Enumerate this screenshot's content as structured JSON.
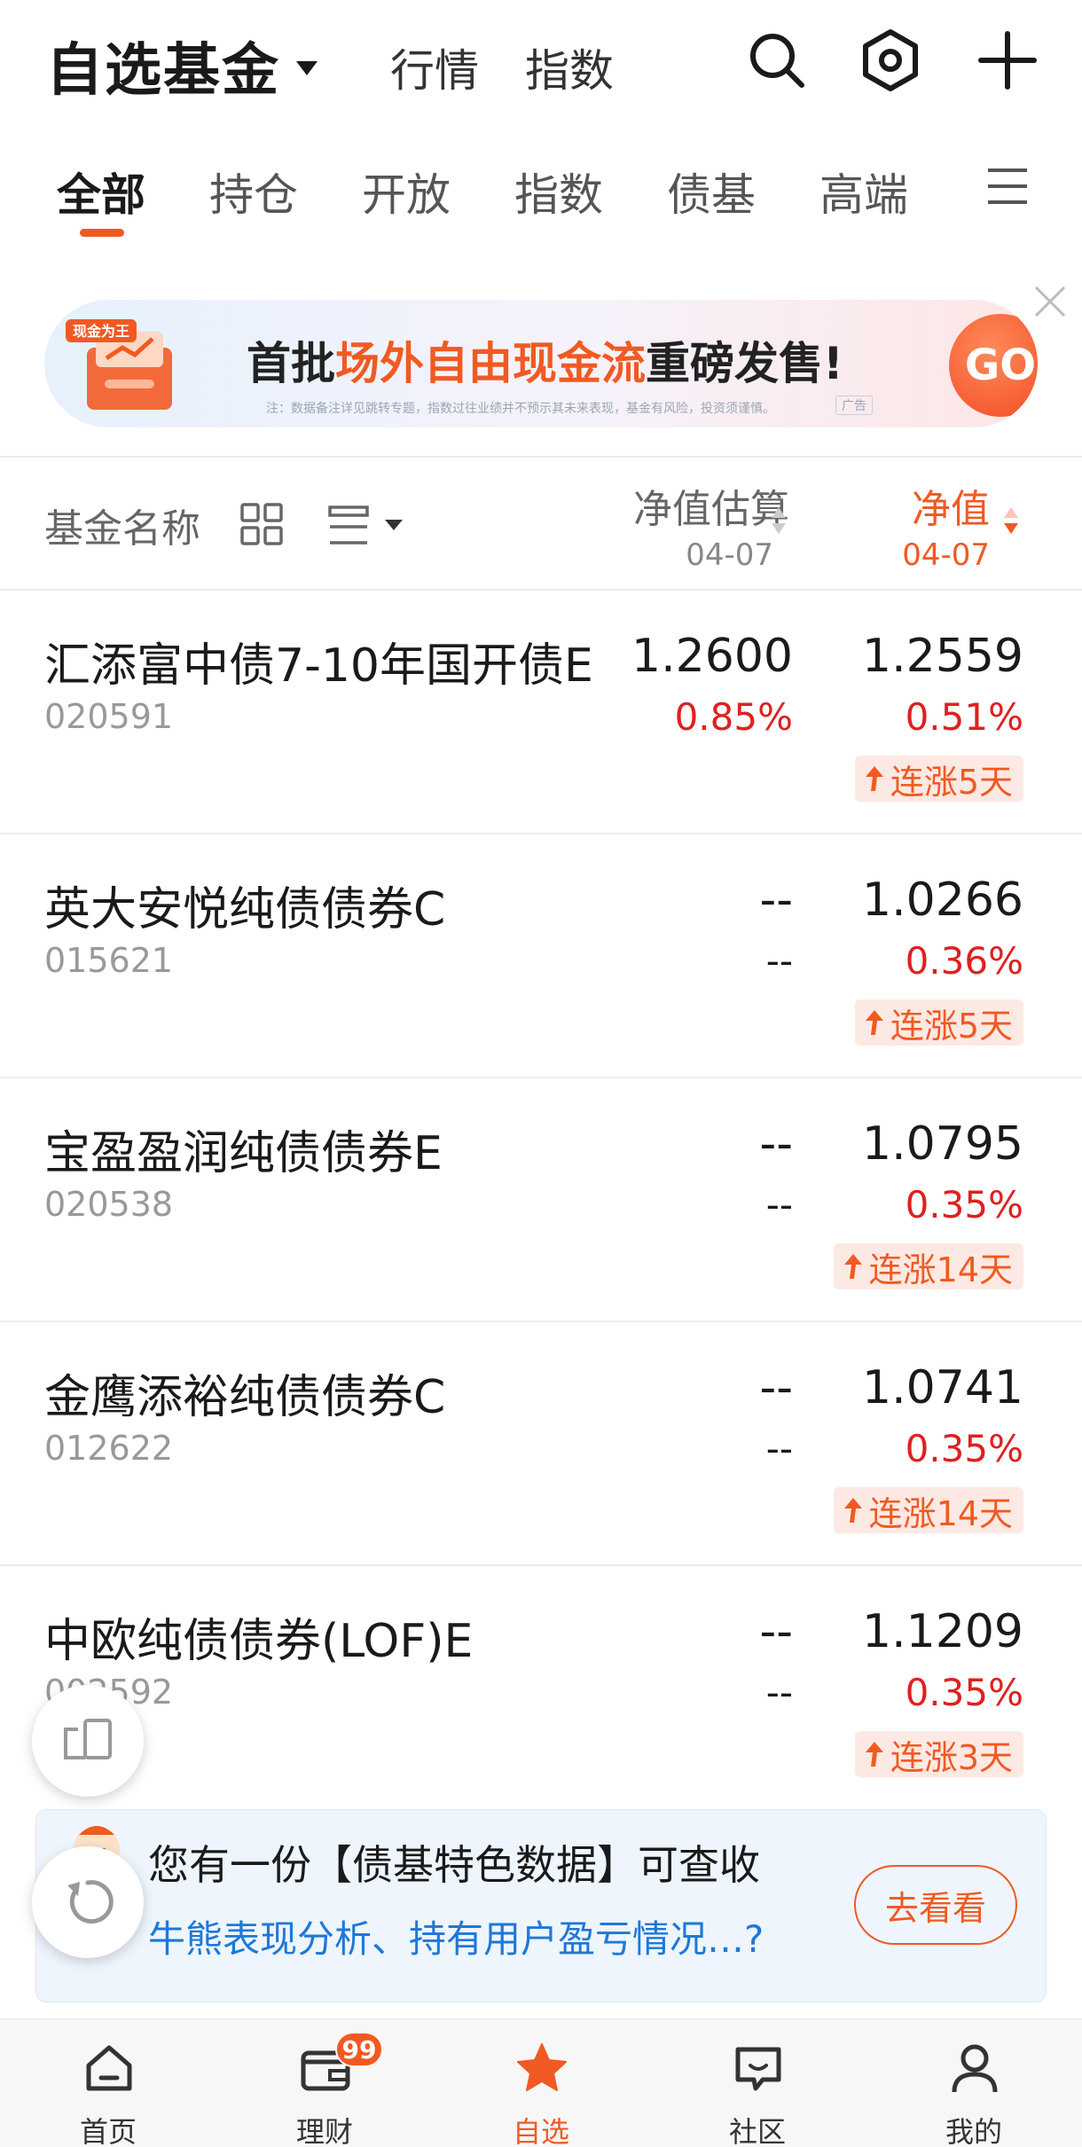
{
  "header": {
    "title": "自选基金",
    "links": [
      "行情",
      "指数"
    ]
  },
  "tabs": [
    "全部",
    "持仓",
    "开放",
    "指数",
    "债基",
    "高端"
  ],
  "banner": {
    "badge_text": "现金为王",
    "text_pre": "首批",
    "text_highlight": "场外自由现金流",
    "text_post": "重磅发售!",
    "note": "注：数据备注详见跳转专题，指数过往业绩并不预示其未来表现，基金有风险，投资须谨慎。",
    "ad_label": "广告",
    "go_label": "GO"
  },
  "columns": {
    "name": "基金名称",
    "estimate_label": "净值估算",
    "estimate_date": "04-07",
    "nav_label": "净值",
    "nav_date": "04-07"
  },
  "funds": [
    {
      "name": "汇添富中债7-10年国开债E",
      "code": "020591",
      "est": "1.2600",
      "est_pct": "0.85%",
      "nav": "1.2559",
      "nav_pct": "0.51%",
      "streak": "连涨5天"
    },
    {
      "name": "英大安悦纯债债券C",
      "code": "015621",
      "est": "--",
      "est_pct": "--",
      "nav": "1.0266",
      "nav_pct": "0.36%",
      "streak": "连涨5天"
    },
    {
      "name": "宝盈盈润纯债债券E",
      "code": "020538",
      "est": "--",
      "est_pct": "--",
      "nav": "1.0795",
      "nav_pct": "0.35%",
      "streak": "连涨14天"
    },
    {
      "name": "金鹰添裕纯债债券C",
      "code": "012622",
      "est": "--",
      "est_pct": "--",
      "nav": "1.0741",
      "nav_pct": "0.35%",
      "streak": "连涨14天"
    },
    {
      "name": "中欧纯债债券(LOF)E",
      "code": "002592",
      "est": "--",
      "est_pct": "--",
      "nav": "1.1209",
      "nav_pct": "0.35%",
      "streak": "连涨3天"
    }
  ],
  "promo": {
    "title": "您有一份【债基特色数据】可查收",
    "subtitle": "牛熊表现分析、持有用户盈亏情况…?",
    "button": "去看看"
  },
  "bottom_nav": [
    {
      "label": "首页",
      "icon": "home-icon"
    },
    {
      "label": "理财",
      "icon": "wallet-icon",
      "badge": "99"
    },
    {
      "label": "自选",
      "icon": "star-icon"
    },
    {
      "label": "社区",
      "icon": "chat-icon"
    },
    {
      "label": "我的",
      "icon": "user-icon"
    }
  ],
  "colors": {
    "accent": "#f05a22",
    "up": "#e02020",
    "link": "#1e78d8"
  }
}
